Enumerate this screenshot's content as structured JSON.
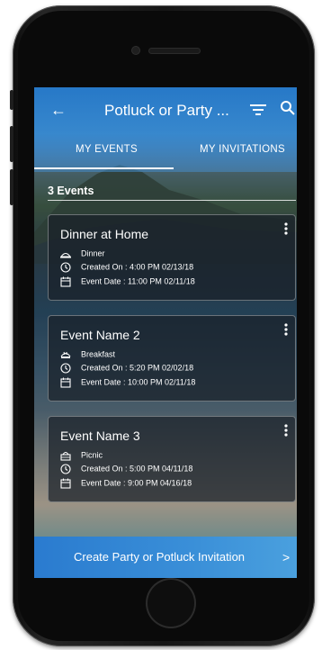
{
  "header": {
    "back_icon": "arrow-left-icon",
    "title": "Potluck or Party ...",
    "filter_icon": "filter-icon",
    "search_icon": "search-icon"
  },
  "tabs": [
    {
      "label": "MY EVENTS",
      "active": true
    },
    {
      "label": "MY INVITATIONS",
      "active": false
    }
  ],
  "events_count": "3 Events",
  "events": [
    {
      "title": "Dinner at Home",
      "type_icon": "dinner-tray-icon",
      "type": "Dinner",
      "created": "Created On : 4:00 PM 02/13/18",
      "event_date": "Event Date : 11:00 PM 02/11/18"
    },
    {
      "title": "Event Name 2",
      "type_icon": "breakfast-icon",
      "type": "Breakfast",
      "created": "Created On : 5:20 PM 02/02/18",
      "event_date": "Event Date : 10:00 PM 02/11/18"
    },
    {
      "title": "Event Name 3",
      "type_icon": "picnic-basket-icon",
      "type": "Picnic",
      "created": "Created On : 5:00 PM 04/11/18",
      "event_date": "Event Date : 9:00 PM 04/16/18"
    }
  ],
  "footer": {
    "label": "Create Party or Potluck Invitation",
    "chevron": ">"
  },
  "colors": {
    "header_blue": "#2578c8",
    "footer_blue": "#3a8fd8",
    "card_bg": "#19202a"
  }
}
